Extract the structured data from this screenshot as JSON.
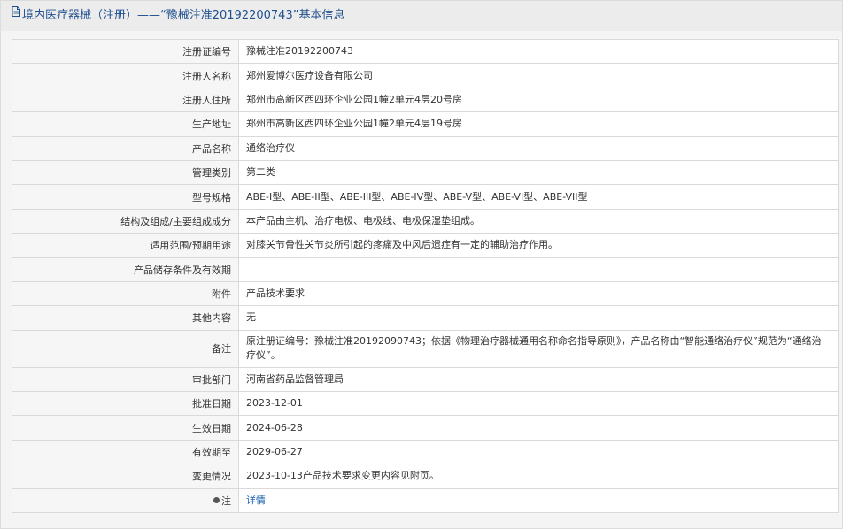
{
  "header": {
    "title": "境内医疗器械（注册）——“豫械注准20192200743”基本信息",
    "icon": "document-icon"
  },
  "rows": [
    {
      "label": "注册证编号",
      "value": "豫械注准20192200743"
    },
    {
      "label": "注册人名称",
      "value": "郑州爱博尔医疗设备有限公司"
    },
    {
      "label": "注册人住所",
      "value": "郑州市高新区西四环企业公园1幢2单元4层20号房"
    },
    {
      "label": "生产地址",
      "value": "郑州市高新区西四环企业公园1幢2单元4层19号房"
    },
    {
      "label": "产品名称",
      "value": "通络治疗仪"
    },
    {
      "label": "管理类别",
      "value": "第二类"
    },
    {
      "label": "型号规格",
      "value": "ABE-I型、ABE-II型、ABE-III型、ABE-IV型、ABE-V型、ABE-VI型、ABE-VII型"
    },
    {
      "label": "结构及组成/主要组成成分",
      "value": "本产品由主机、治疗电极、电极线、电极保湿垫组成。"
    },
    {
      "label": "适用范围/预期用途",
      "value": "对膝关节骨性关节炎所引起的疼痛及中风后遗症有一定的辅助治疗作用。"
    },
    {
      "label": "产品储存条件及有效期",
      "value": ""
    },
    {
      "label": "附件",
      "value": "产品技术要求"
    },
    {
      "label": "其他内容",
      "value": "无"
    },
    {
      "label": "备注",
      "value": "原注册证编号：豫械注准20192090743；依据《物理治疗器械通用名称命名指导原则》，产品名称由“智能通络治疗仪”规范为“通络治疗仪”。"
    },
    {
      "label": "审批部门",
      "value": "河南省药品监督管理局"
    },
    {
      "label": "批准日期",
      "value": "2023-12-01"
    },
    {
      "label": "生效日期",
      "value": "2024-06-28"
    },
    {
      "label": "有效期至",
      "value": "2029-06-27"
    },
    {
      "label": "变更情况",
      "value": "2023-10-13产品技术要求变更内容见附页。"
    }
  ],
  "note_row": {
    "label": "注",
    "icon": "pin-icon",
    "link_text": "详情"
  },
  "colors": {
    "header_text": "#1e4f8f",
    "link": "#1e63b0",
    "border": "#d9d9d9"
  }
}
